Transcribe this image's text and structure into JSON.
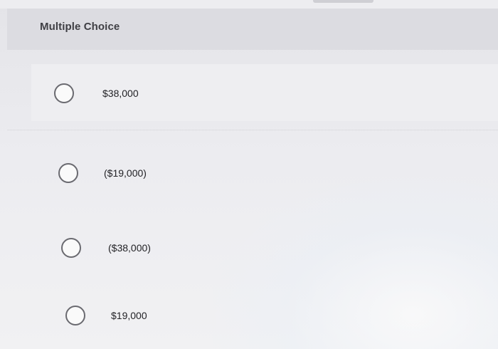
{
  "header": {
    "title": "Multiple Choice"
  },
  "options": [
    {
      "label": "$38,000"
    },
    {
      "label": "($19,000)"
    },
    {
      "label": "($38,000)"
    },
    {
      "label": "$19,000"
    }
  ],
  "colors": {
    "header_bg": "#dcdce1",
    "radio_border": "#6a6a70",
    "text": "#222226"
  }
}
